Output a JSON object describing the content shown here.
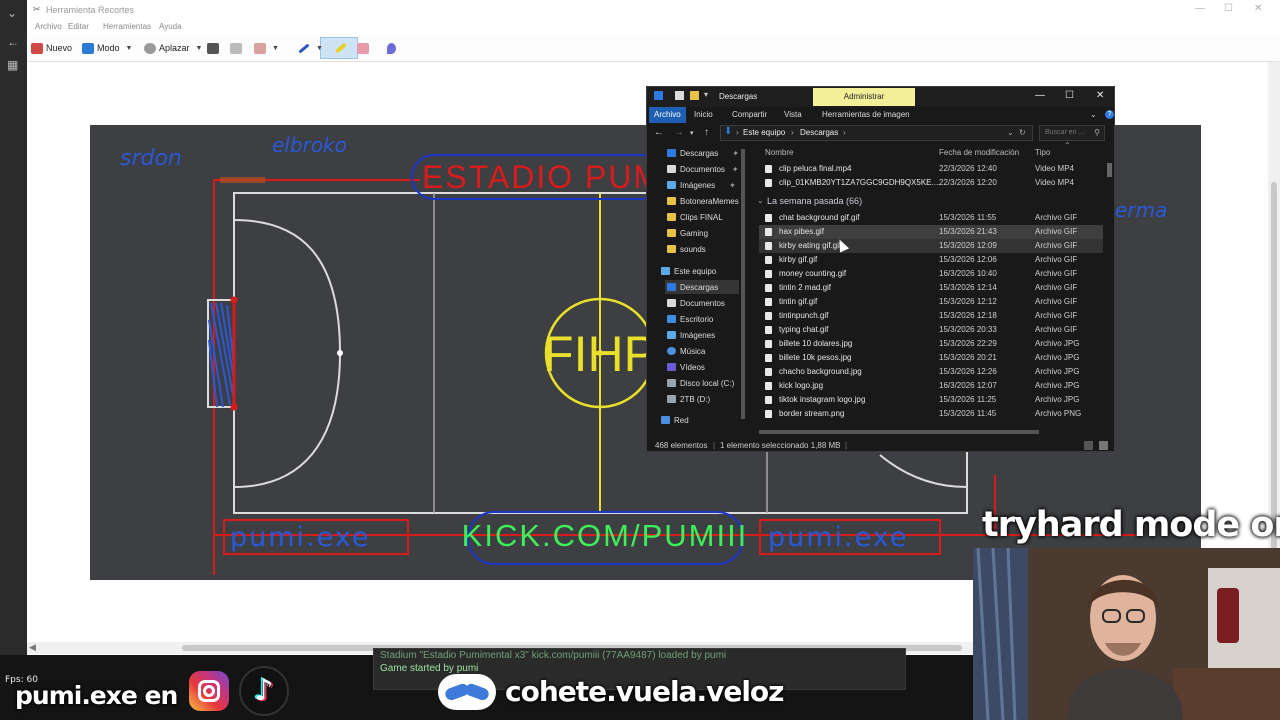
{
  "snipping_tool": {
    "title": "Herramienta Recortes",
    "menu": [
      "Archivo",
      "Editar",
      "Herramientas",
      "Ayuda"
    ],
    "toolbar": {
      "new_label": "Nuevo",
      "mode_label": "Modo",
      "delay_label": "Aplazar"
    }
  },
  "pitch": {
    "stadium_title": "ESTADIO PUM",
    "center_logo": "FIHP",
    "banner_center": "KICK.COM/PUMIII",
    "banner_left": "pumi.exe",
    "banner_right": "pumi.exe",
    "scribble_1": "srdon",
    "scribble_2": "elbroko",
    "scribble_3": "erma",
    "colors": {
      "field_bg": "#3d3f42",
      "lines": "#dcdcdc",
      "center": "#e8e02a",
      "red": "#d81b1b",
      "blue": "#1c35c9",
      "green": "#3df05a"
    }
  },
  "explorer": {
    "title": "Descargas",
    "context_tab": "Administrar",
    "ribbon_tabs": [
      "Archivo",
      "Inicio",
      "Compartir",
      "Vista",
      "Herramientas de imagen"
    ],
    "help": "?",
    "breadcrumb": [
      "Este equipo",
      "Descargas"
    ],
    "search_placeholder": "Buscar en ...",
    "quick_access": [
      "Descargas",
      "Documentos",
      "Imágenes",
      "BotoneraMemes",
      "Clips FINAL",
      "Gaming",
      "sounds"
    ],
    "this_pc_label": "Este equipo",
    "this_pc": [
      "Descargas",
      "Documentos",
      "Escritorio",
      "Imágenes",
      "Música",
      "Vídeos",
      "Disco local (C:)",
      "2TB (D:)"
    ],
    "network_label": "Red",
    "columns": {
      "name": "Nombre",
      "date": "Fecha de modificación",
      "type": "Tipo"
    },
    "top_files": [
      {
        "name": "clip peluca final.mp4",
        "date": "22/3/2026 12:40",
        "type": "Video MP4"
      },
      {
        "name": "clip_01KMB20YT1ZA7GGC9GDH9QX5KE....",
        "date": "22/3/2026 12:20",
        "type": "Video MP4"
      }
    ],
    "group_label": "La semana pasada (66)",
    "files": [
      {
        "name": "chat background gif.gif",
        "date": "15/3/2026 11:55",
        "type": "Archivo GIF"
      },
      {
        "name": "hax pibes.gif",
        "date": "15/3/2026 21:43",
        "type": "Archivo GIF"
      },
      {
        "name": "kirby eating gif.gif",
        "date": "15/3/2026 12:09",
        "type": "Archivo GIF"
      },
      {
        "name": "kirby gif.gif",
        "date": "15/3/2026 12:06",
        "type": "Archivo GIF"
      },
      {
        "name": "money counting.gif",
        "date": "16/3/2026 10:40",
        "type": "Archivo GIF"
      },
      {
        "name": "tintin 2 mad.gif",
        "date": "15/3/2026 12:14",
        "type": "Archivo GIF"
      },
      {
        "name": "tintin gif.gif",
        "date": "15/3/2026 12:12",
        "type": "Archivo GIF"
      },
      {
        "name": "tintinpunch.gif",
        "date": "15/3/2026 12:18",
        "type": "Archivo GIF"
      },
      {
        "name": "typing chat.gif",
        "date": "15/3/2026 20:33",
        "type": "Archivo GIF"
      },
      {
        "name": "billete 10 dolares.jpg",
        "date": "15/3/2026 22:29",
        "type": "Archivo JPG"
      },
      {
        "name": "billete 10k pesos.jpg",
        "date": "15/3/2026 20:21",
        "type": "Archivo JPG"
      },
      {
        "name": "chacho background.jpg",
        "date": "15/3/2026 12:26",
        "type": "Archivo JPG"
      },
      {
        "name": "kick logo.jpg",
        "date": "16/3/2026 12:07",
        "type": "Archivo JPG"
      },
      {
        "name": "tiktok instagram logo.jpg",
        "date": "15/3/2026 11:25",
        "type": "Archivo JPG"
      },
      {
        "name": "border stream.png",
        "date": "15/3/2026 11:45",
        "type": "Archivo PNG"
      }
    ],
    "status": {
      "count": "468 elementos",
      "selected": "1 elemento seleccionado  1,88 MB"
    }
  },
  "game": {
    "chat_line_1": "Stadium \"Estadio Pumimental x3\" kick.com/pumiii (77AA9487) loaded by pumi",
    "chat_line_2": "Game started by pumi",
    "fps": "Fps: 60"
  },
  "overlay": {
    "social_left": "pumi.exe en",
    "social_right": "cohete.vuela.veloz",
    "mode_text": "tryhard mode on"
  }
}
